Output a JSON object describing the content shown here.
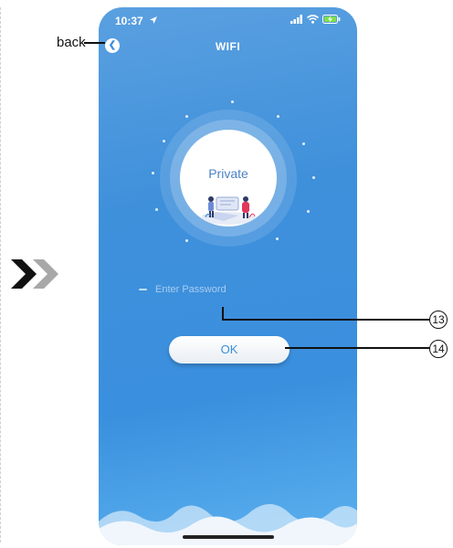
{
  "status_bar": {
    "time": "10:37",
    "location_icon": "location-arrow-icon",
    "signal_icon": "signal-icon",
    "wifi_icon": "wifi-icon",
    "battery_icon": "battery-charging-icon"
  },
  "header": {
    "title": "WIFI",
    "back_icon": "chevron-left-icon"
  },
  "network": {
    "name": "Private"
  },
  "password": {
    "placeholder": "Enter Password",
    "value": ""
  },
  "ok_button": {
    "label": "OK"
  },
  "annotations": {
    "back": "back",
    "callout_13": "13",
    "callout_14": "14"
  },
  "colors": {
    "accent": "#3a8fde",
    "network_name": "#4c82c4",
    "background_top": "#5aa0e0",
    "background_bottom": "#5cb2ef"
  }
}
